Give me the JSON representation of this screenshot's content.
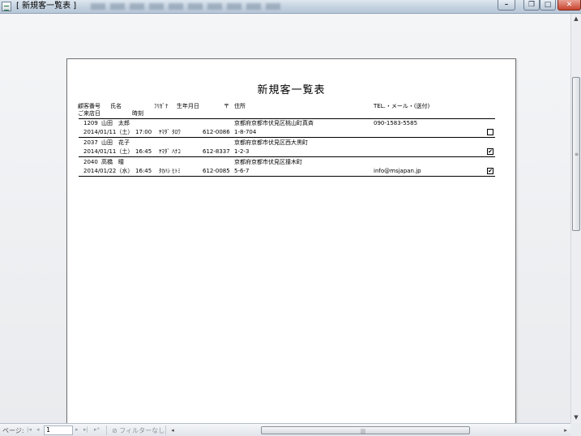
{
  "window": {
    "title": "[ 新規客一覧表 ]",
    "min_glyph": "–",
    "restore_glyph": "❐",
    "max_glyph": "□",
    "close_glyph": "✕"
  },
  "report": {
    "title": "新規客一覧表",
    "headers": {
      "customer_no": "顧客番号",
      "name": "氏名",
      "furigana": "ﾌﾘｶﾞﾅ",
      "birthdate": "生年月日",
      "zip": "〒",
      "address": "住所",
      "contact": "TEL.・メール・(送付)",
      "visit_date": "ご来店日",
      "time": "時刻"
    },
    "rows": [
      {
        "customer_no": "1209",
        "name": "山田　太郎",
        "visit_date": "2014/01/11（土）",
        "time": "17:00",
        "furigana": "ﾔﾏﾀﾞ ﾀﾛｳ",
        "zip": "612-0086",
        "address_line1": "京都府京都市伏見区桃山町真斉",
        "address_line2": "1-8-704",
        "contact": "090-1583-5585",
        "checked": false
      },
      {
        "customer_no": "2037",
        "name": "山田　花子",
        "visit_date": "2014/01/11（土）",
        "time": "16:45",
        "furigana": "ﾔﾏﾀﾞ ﾊﾅｺ",
        "zip": "612-8337",
        "address_line1": "京都府京都市伏見区西大黒町",
        "address_line2": "1-2-3",
        "contact": "",
        "checked": true
      },
      {
        "customer_no": "2040",
        "name": "高橋　瞳",
        "visit_date": "2014/01/22（水）",
        "time": "16:45",
        "furigana": "ﾀｶﾊｼ ﾋﾄﾐ",
        "zip": "612-0085",
        "address_line1": "京都府京都市伏見区撞木町",
        "address_line2": "5-6-7",
        "contact": "info@msjapan.jp",
        "checked": true
      }
    ]
  },
  "navbar": {
    "page_label": "ページ:",
    "nav_first": "|◂",
    "nav_prev": "◂",
    "page_value": "1",
    "nav_next": "▸",
    "nav_last": "▸|",
    "nav_new": "▸*",
    "filter_label": "フィルターなし",
    "filter_icon": "⊘",
    "hscroll_left": "◂",
    "hscroll_right": "▸",
    "grip": "|||"
  },
  "vscroll": {
    "up": "▲",
    "down": "▼",
    "grip": "≡"
  },
  "icons": {
    "app_icon": "access-report-icon",
    "filter_icon": "no-filter-icon"
  }
}
